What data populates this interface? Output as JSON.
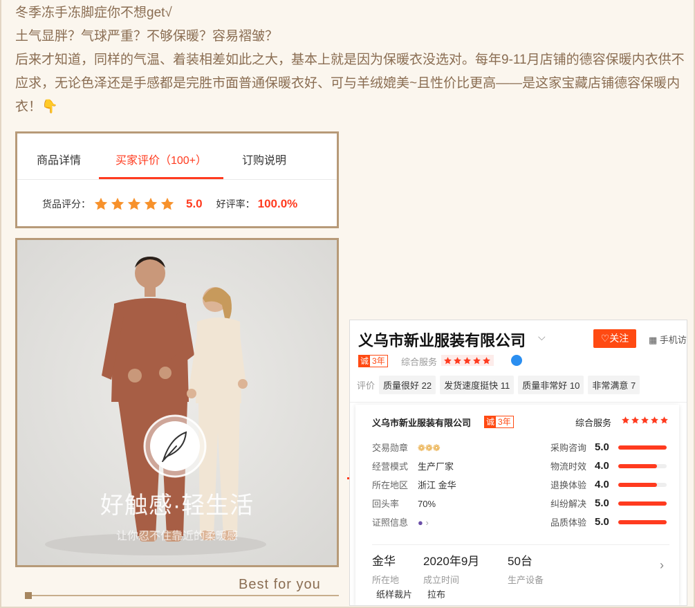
{
  "intro": {
    "line1": "冬季冻手冻脚症你不想get√",
    "line2": "土气显胖？气球严重？不够保暖？容易褶皱？",
    "line3": "后来才知道，同样的气温、着装相差如此之大，基本上就是因为保暖衣没选对。每年9-11月店铺的德容保暖内衣供不应求，无论色泽还是手感都是完胜市面普通保暖衣好、可与羊绒媲美~且性价比更高——是这家宝藏店铺德容保暖内衣！👇"
  },
  "tabs": {
    "items": [
      "商品详情",
      "买家评价（100+）",
      "订购说明"
    ],
    "rating_label": "货品评分：",
    "rating_value": "5.0",
    "rating_stars": 5,
    "positive_label": "好评率：",
    "positive_value": "100.0%"
  },
  "photo": {
    "slogan": "好触感·轻生活",
    "subtitle": "让你忍不住靠近的柔暖感",
    "icon": "feather-icon",
    "colors": {
      "man_suit": "#a75e45",
      "woman_suit": "#f1e5d4",
      "background": "#e4e3e0"
    }
  },
  "best_for_you": "Best for you",
  "shop": {
    "name": "义乌市新业服装有限公司",
    "follow_label": "关注",
    "mobile_label": "手机访",
    "badge_left": "诚",
    "badge_right": "3年",
    "service_label": "综合服务",
    "review_label": "评价",
    "reviews": [
      {
        "text": "质量很好",
        "count": "22"
      },
      {
        "text": "发货速度挺快",
        "count": "11"
      },
      {
        "text": "质量非常好",
        "count": "10"
      },
      {
        "text": "非常满意",
        "count": "7"
      }
    ],
    "card": {
      "name": "义乌市新业服装有限公司",
      "composite_label": "综合服务",
      "details": [
        {
          "key": "交易勋章",
          "value": ""
        },
        {
          "key": "经营模式",
          "value": "生产厂家"
        },
        {
          "key": "所在地区",
          "value": "浙江 金华"
        },
        {
          "key": "回头率",
          "value": "70%"
        },
        {
          "key": "证照信息",
          "value": ""
        }
      ],
      "scores": [
        {
          "label": "采购咨询",
          "value": "5.0",
          "fill": 1.0
        },
        {
          "label": "物流时效",
          "value": "4.0",
          "fill": 0.8
        },
        {
          "label": "退换体验",
          "value": "4.0",
          "fill": 0.8
        },
        {
          "label": "纠纷解决",
          "value": "5.0",
          "fill": 1.0
        },
        {
          "label": "品质体验",
          "value": "5.0",
          "fill": 1.0
        }
      ],
      "stats": [
        {
          "value": "金华",
          "label": "所在地"
        },
        {
          "value": "2020年9月",
          "label": "成立时间"
        },
        {
          "value": "50台",
          "label": "生产设备"
        }
      ],
      "caps": [
        "纸样裁片",
        "拉布"
      ]
    }
  }
}
